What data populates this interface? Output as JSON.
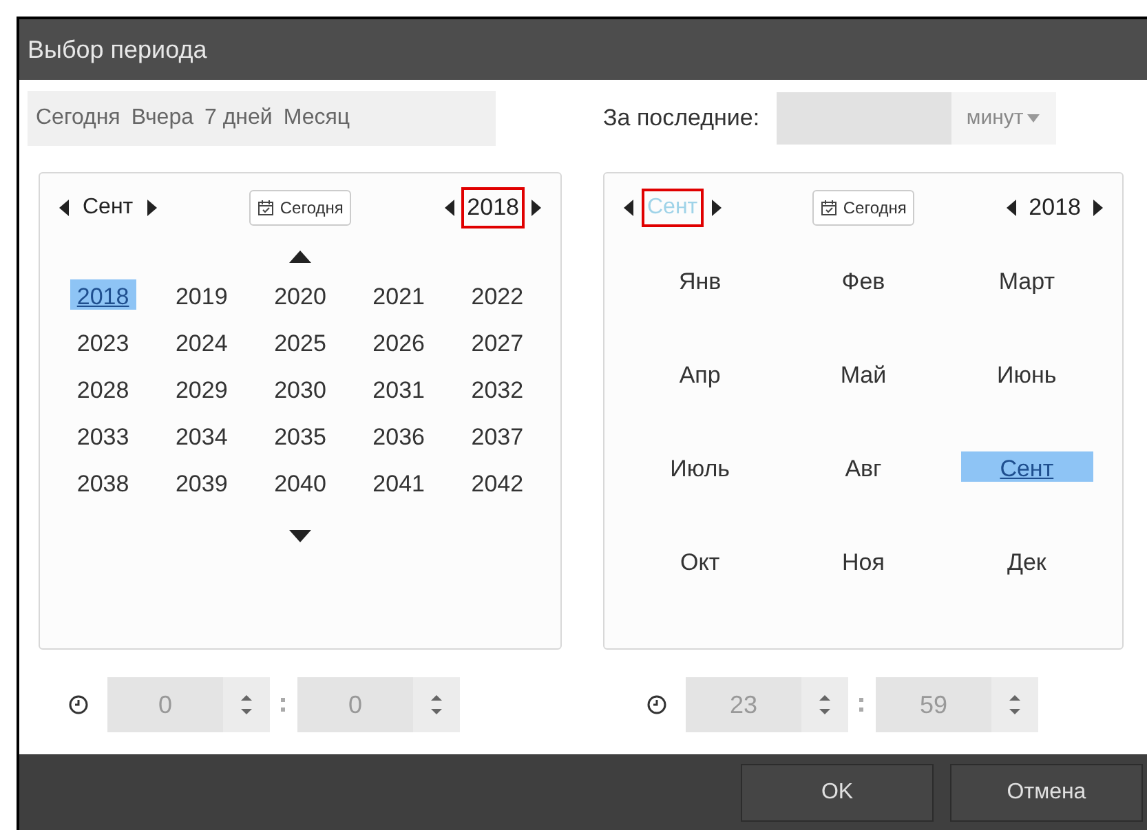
{
  "window": {
    "title": "Выбор периода"
  },
  "quick_ranges": [
    {
      "label": "Сегодня"
    },
    {
      "label": "Вчера"
    },
    {
      "label": "7 дней"
    },
    {
      "label": "Месяц"
    }
  ],
  "last": {
    "label": "За последние:",
    "unit": "минут"
  },
  "calendars": [
    {
      "kind": "years",
      "month": "Сент",
      "today": "Сегодня",
      "year": "2018",
      "month_highlighted": false,
      "year_highlighted": true,
      "month_faded": false,
      "items": [
        {
          "label": "2018",
          "selected": true
        },
        {
          "label": "2019",
          "selected": false
        },
        {
          "label": "2020",
          "selected": false
        },
        {
          "label": "2021",
          "selected": false
        },
        {
          "label": "2022",
          "selected": false
        },
        {
          "label": "2023",
          "selected": false
        },
        {
          "label": "2024",
          "selected": false
        },
        {
          "label": "2025",
          "selected": false
        },
        {
          "label": "2026",
          "selected": false
        },
        {
          "label": "2027",
          "selected": false
        },
        {
          "label": "2028",
          "selected": false
        },
        {
          "label": "2029",
          "selected": false
        },
        {
          "label": "2030",
          "selected": false
        },
        {
          "label": "2031",
          "selected": false
        },
        {
          "label": "2032",
          "selected": false
        },
        {
          "label": "2033",
          "selected": false
        },
        {
          "label": "2034",
          "selected": false
        },
        {
          "label": "2035",
          "selected": false
        },
        {
          "label": "2036",
          "selected": false
        },
        {
          "label": "2037",
          "selected": false
        },
        {
          "label": "2038",
          "selected": false
        },
        {
          "label": "2039",
          "selected": false
        },
        {
          "label": "2040",
          "selected": false
        },
        {
          "label": "2041",
          "selected": false
        },
        {
          "label": "2042",
          "selected": false
        }
      ],
      "time": {
        "hours": "0",
        "minutes": "0"
      }
    },
    {
      "kind": "months",
      "month": "Сент",
      "today": "Сегодня",
      "year": "2018",
      "month_highlighted": true,
      "year_highlighted": false,
      "month_faded": true,
      "items": [
        {
          "label": "Янв",
          "selected": false
        },
        {
          "label": "Фев",
          "selected": false
        },
        {
          "label": "Март",
          "selected": false
        },
        {
          "label": "Апр",
          "selected": false
        },
        {
          "label": "Май",
          "selected": false
        },
        {
          "label": "Июнь",
          "selected": false
        },
        {
          "label": "Июль",
          "selected": false
        },
        {
          "label": "Авг",
          "selected": false
        },
        {
          "label": "Сент",
          "selected": true
        },
        {
          "label": "Окт",
          "selected": false
        },
        {
          "label": "Ноя",
          "selected": false
        },
        {
          "label": "Дек",
          "selected": false
        }
      ],
      "time": {
        "hours": "23",
        "minutes": "59"
      }
    }
  ],
  "buttons": [
    {
      "label": "OK"
    },
    {
      "label": "Отмена"
    }
  ]
}
